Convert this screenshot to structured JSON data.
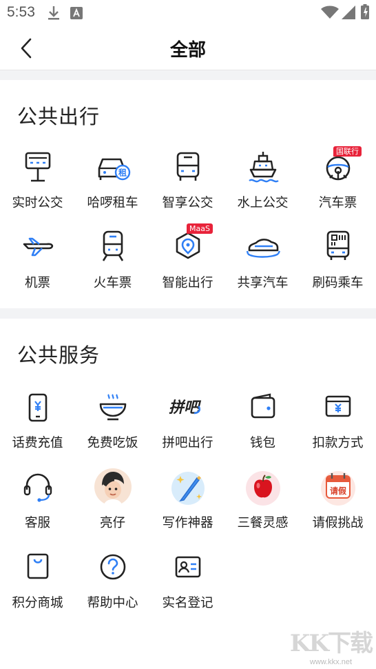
{
  "status_bar": {
    "time": "5:53"
  },
  "header": {
    "title": "全部"
  },
  "sections": [
    {
      "title": "公共出行",
      "items": [
        {
          "label": "实时公交",
          "icon": "bus-stop-icon"
        },
        {
          "label": "哈啰租车",
          "icon": "car-rental-icon"
        },
        {
          "label": "智享公交",
          "icon": "bus-icon"
        },
        {
          "label": "水上公交",
          "icon": "ferry-icon"
        },
        {
          "label": "汽车票",
          "icon": "steering-wheel-icon",
          "badge": "国联行"
        },
        {
          "label": "机票",
          "icon": "airplane-icon"
        },
        {
          "label": "火车票",
          "icon": "train-icon"
        },
        {
          "label": "智能出行",
          "icon": "location-pin-icon",
          "badge": "MaaS"
        },
        {
          "label": "共享汽车",
          "icon": "shared-car-icon"
        },
        {
          "label": "刷码乘车",
          "icon": "qr-bus-icon"
        }
      ]
    },
    {
      "title": "公共服务",
      "items": [
        {
          "label": "话费充值",
          "icon": "phone-recharge-icon"
        },
        {
          "label": "免费吃饭",
          "icon": "bowl-icon"
        },
        {
          "label": "拼吧出行",
          "icon": "pinba-logo-icon",
          "icon_text": "拼吧"
        },
        {
          "label": "钱包",
          "icon": "wallet-icon"
        },
        {
          "label": "扣款方式",
          "icon": "payment-card-icon"
        },
        {
          "label": "客服",
          "icon": "headset-icon"
        },
        {
          "label": "亮仔",
          "icon": "avatar-icon"
        },
        {
          "label": "写作神器",
          "icon": "pen-sparkle-icon"
        },
        {
          "label": "三餐灵感",
          "icon": "apple-icon"
        },
        {
          "label": "请假挑战",
          "icon": "calendar-icon",
          "icon_text": "请假"
        },
        {
          "label": "积分商城",
          "icon": "shopping-bag-icon"
        },
        {
          "label": "帮助中心",
          "icon": "help-icon"
        },
        {
          "label": "实名登记",
          "icon": "id-card-icon"
        }
      ]
    }
  ],
  "watermark": {
    "logo": "KK下载",
    "url": "www.kkx.net"
  },
  "colors": {
    "accent": "#2f7ff5",
    "badge": "#e8233a",
    "text": "#222222",
    "background": "#f2f3f5"
  }
}
